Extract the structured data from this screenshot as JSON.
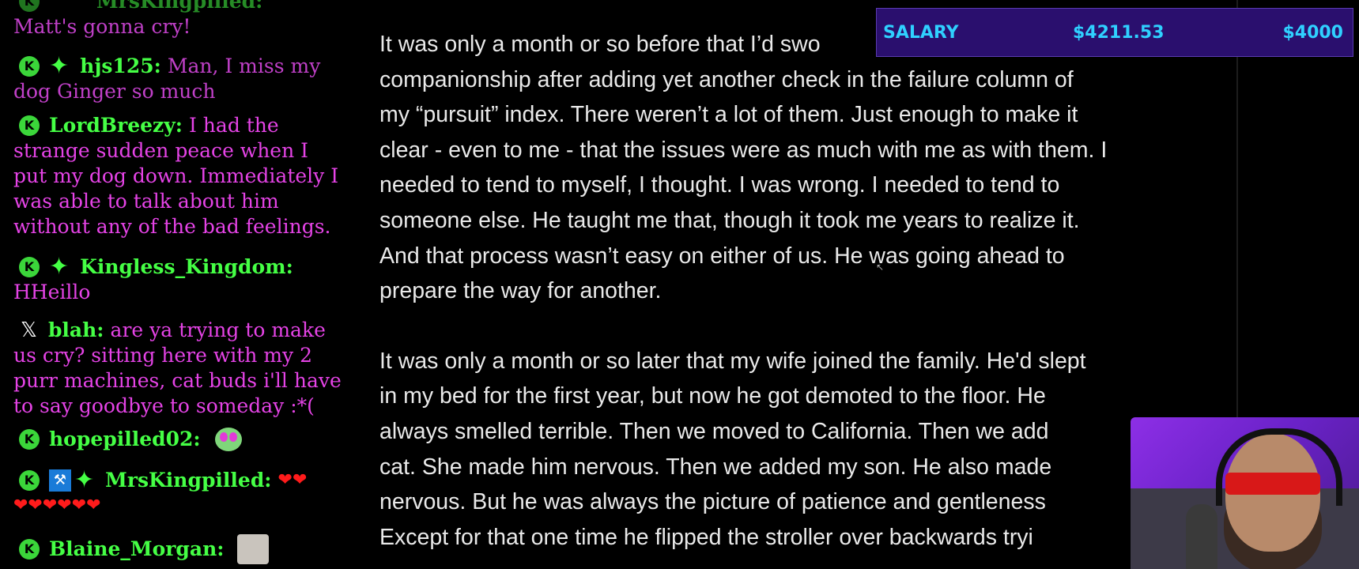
{
  "chat": {
    "partial_top": {
      "user": "MrsKingpilled:",
      "text": "Matt's gonna cry!"
    },
    "messages": [
      {
        "user": "hjs125:",
        "text_line1": "Man, I miss my",
        "text_line2": "dog Ginger so much"
      },
      {
        "user": "LordBreezy:",
        "text_line1": "I had the",
        "lines": [
          "strange sudden peace when I",
          "put my dog down. Immediately I",
          "was able to talk about him",
          "without any of the bad feelings."
        ]
      },
      {
        "user": "Kingless_Kingdom:",
        "text_line2": "HHeillo"
      },
      {
        "user": "blah:",
        "text_line1": "are ya trying to make",
        "lines": [
          "us cry? sitting here with my 2",
          "purr machines, cat buds i'll have",
          "to say goodbye to someday :*("
        ]
      },
      {
        "user": "hopepilled02:"
      },
      {
        "user": "MrsKingpilled:",
        "hearts1": "❤❤",
        "hearts2": "❤❤❤❤❤❤"
      },
      {
        "user": "Blaine_Morgan:"
      }
    ],
    "icons": {
      "k_badge": "K",
      "star_badge": "✦",
      "x_badge": "𝕏",
      "hammer_badge": "⚒"
    }
  },
  "article": {
    "paragraphs": [
      [
        "It was only a month or so before that I’d swo",
        "companionship after adding yet another check in the failure column of",
        "my “pursuit” index. There weren’t a lot of them. Just enough to make it",
        "clear - even to me - that the issues were as much with me as with them. I",
        "needed to tend to myself, I thought. I was wrong. I needed to tend to",
        "someone else. He taught me that, though it took me years to realize it.",
        "And that process wasn’t easy on either of us. He was going ahead to",
        "prepare the way for another."
      ],
      [
        "It was only a month or so later that my wife joined the family. He'd slept",
        "in my bed for the first year, but now he got demoted to the floor. He",
        "always smelled terrible. Then we moved to California. Then we add",
        "cat. She made him nervous. Then we added my son. He also made",
        "nervous. But he was always the picture of patience and gentleness",
        "Except for that one time he flipped the stroller over backwards tryi"
      ]
    ]
  },
  "salary_overlay": {
    "label": "SALARY",
    "value_current": "$4211.53",
    "value_target": "$4000",
    "colors": {
      "background": "#2a0f6e",
      "text": "#2fd0ff"
    }
  },
  "colors": {
    "username": "#45ff45",
    "chat_text_pink": "#e543e6",
    "chat_text_purple": "#c040c8",
    "article_text": "#e9e9e9"
  }
}
